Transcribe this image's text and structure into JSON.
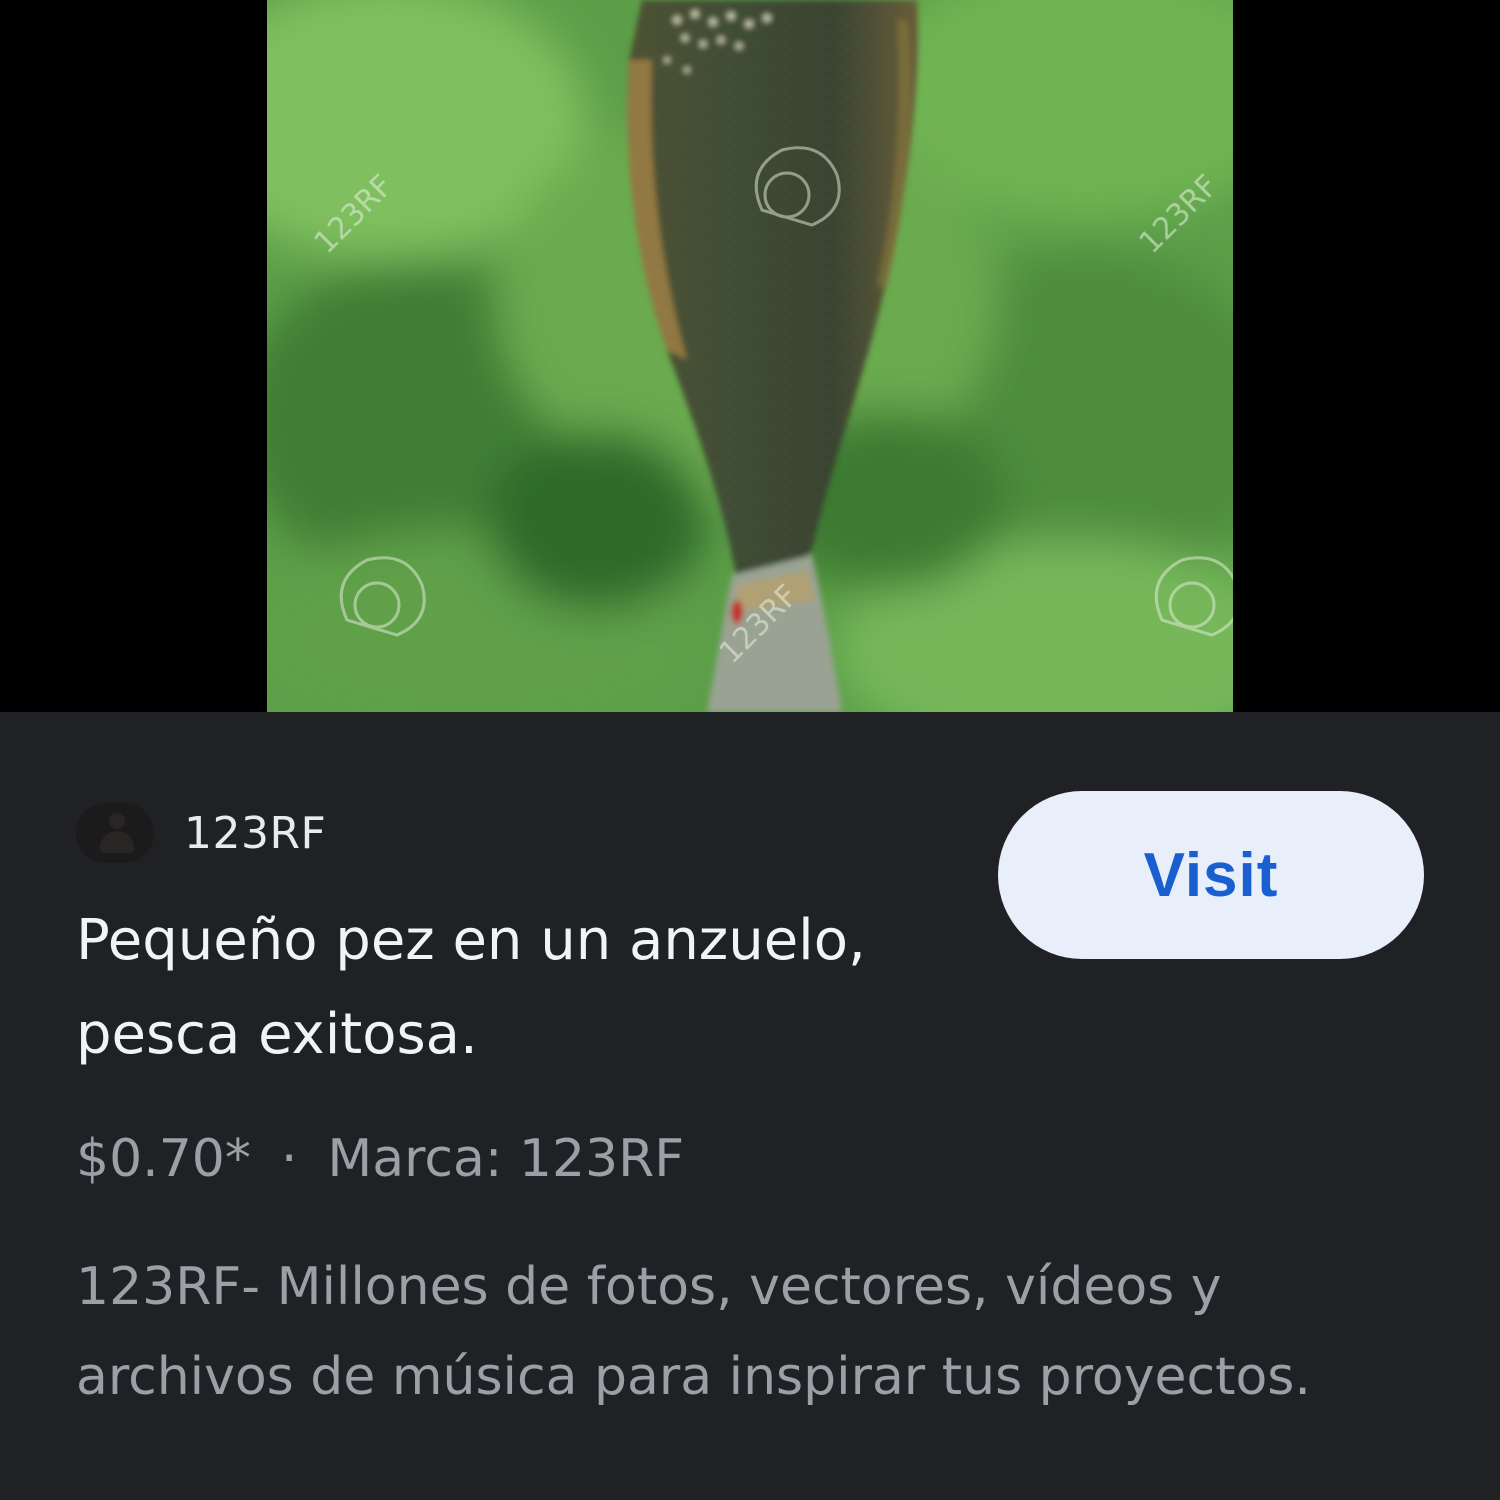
{
  "result": {
    "source": {
      "name": "123RF",
      "favicon_icon": "123rf-person-icon"
    },
    "visit_label": "Visit",
    "title": "Pequeño pez en un anzuelo, pesca exitosa.",
    "price": "$0.70*",
    "separator": "·",
    "brand": "Marca: 123RF",
    "description": "123RF- Millones de fotos, vectores, vídeos y archivos de música para inspirar tus proyectos.",
    "image": {
      "watermark_text": "123RF"
    }
  },
  "colors": {
    "panel_background": "#202124",
    "visit_button_background": "#e9eefb",
    "visit_button_text": "#1a5fd0",
    "title_text": "#f1f3f4",
    "secondary_text": "#9aa0a6"
  }
}
